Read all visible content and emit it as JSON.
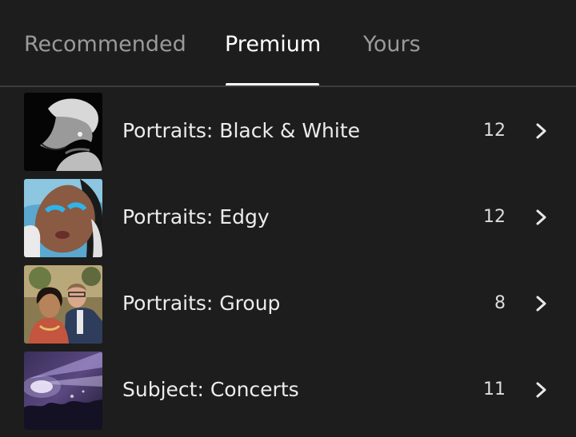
{
  "tabs": [
    {
      "label": "Recommended",
      "active": false
    },
    {
      "label": "Premium",
      "active": true
    },
    {
      "label": "Yours",
      "active": false
    }
  ],
  "collections": [
    {
      "label": "Portraits: Black & White",
      "count": "12",
      "thumbnail_icon": "portrait-bw-thumbnail"
    },
    {
      "label": "Portraits: Edgy",
      "count": "12",
      "thumbnail_icon": "portrait-edgy-thumbnail"
    },
    {
      "label": "Portraits: Group",
      "count": "8",
      "thumbnail_icon": "portrait-group-thumbnail"
    },
    {
      "label": "Subject: Concerts",
      "count": "11",
      "thumbnail_icon": "concert-thumbnail"
    }
  ],
  "colors": {
    "background": "#1d1d1d",
    "active_tab": "#ffffff",
    "inactive_tab": "#9a9a9a",
    "divider": "#3c3c3c"
  }
}
